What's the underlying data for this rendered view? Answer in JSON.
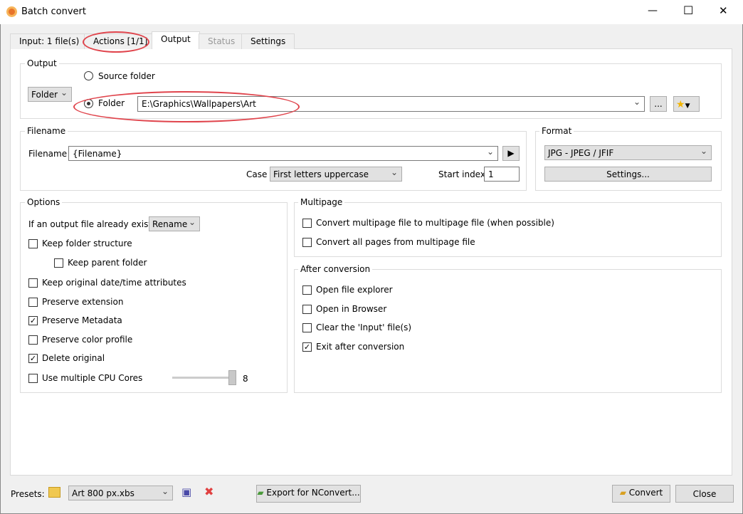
{
  "window": {
    "title": "Batch convert",
    "minimize": "—",
    "maximize": "☐",
    "close": "✕"
  },
  "tabs": [
    {
      "label": "Input: 1 file(s)"
    },
    {
      "label": "Actions [1/1]"
    },
    {
      "label": "Output"
    },
    {
      "label": "Status"
    },
    {
      "label": "Settings"
    }
  ],
  "output": {
    "group": "Output",
    "mode": "Folder",
    "source_folder": "Source folder",
    "folder": "Folder",
    "path": "E:\\Graphics\\Wallpapers\\Art",
    "browse": "..."
  },
  "filename": {
    "group": "Filename",
    "label": "Filename",
    "value": "{Filename}",
    "case_label": "Case",
    "case_value": "First letters uppercase",
    "start_index_label": "Start index",
    "start_index": "1"
  },
  "format": {
    "group": "Format",
    "value": "JPG - JPEG / JFIF",
    "settings": "Settings..."
  },
  "options": {
    "group": "Options",
    "exists_label": "If an output file already exists",
    "exists_value": "Rename",
    "items": [
      {
        "label": "Keep folder structure",
        "checked": false
      },
      {
        "label": "Keep parent folder",
        "checked": false
      },
      {
        "label": "Keep original date/time attributes",
        "checked": false
      },
      {
        "label": "Preserve extension",
        "checked": false
      },
      {
        "label": "Preserve Metadata",
        "checked": true
      },
      {
        "label": "Preserve color profile",
        "checked": false
      },
      {
        "label": "Delete original",
        "checked": true
      },
      {
        "label": "Use multiple CPU Cores",
        "checked": false
      }
    ],
    "cpu_cores": "8",
    "cpu_slider_fraction": 1.0
  },
  "multipage": {
    "group": "Multipage",
    "items": [
      {
        "label": "Convert multipage file to multipage file (when possible)",
        "checked": false
      },
      {
        "label": "Convert all pages from multipage file",
        "checked": false
      }
    ]
  },
  "after": {
    "group": "After conversion",
    "items": [
      {
        "label": "Open file explorer",
        "checked": false
      },
      {
        "label": "Open in Browser",
        "checked": false
      },
      {
        "label": "Clear the 'Input' file(s)",
        "checked": false
      },
      {
        "label": "Exit after conversion",
        "checked": true
      }
    ]
  },
  "footer": {
    "presets_label": "Presets:",
    "preset": "Art 800 px.xbs",
    "export": "Export for NConvert...",
    "convert": "Convert",
    "close": "Close"
  }
}
